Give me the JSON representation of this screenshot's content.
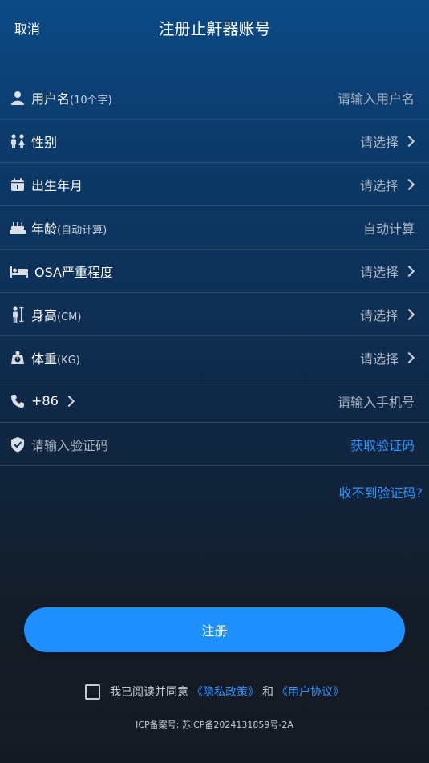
{
  "header": {
    "cancel": "取消",
    "title": "注册止鼾器账号"
  },
  "form": {
    "username": {
      "label": "用户名",
      "hint": "(10个字)",
      "placeholder": "请输入用户名"
    },
    "gender": {
      "label": "性别",
      "value": "请选择"
    },
    "birth": {
      "label": "出生年月",
      "value": "请选择"
    },
    "age": {
      "label": "年龄",
      "hint": "(自动计算)",
      "value": "自动计算"
    },
    "osa": {
      "label": "OSA严重程度",
      "value": "请选择"
    },
    "height": {
      "label": "身高",
      "hint": "(CM)",
      "value": "请选择"
    },
    "weight": {
      "label": "体重",
      "hint": "(KG)",
      "value": "请选择"
    },
    "phone": {
      "code": "+86",
      "placeholder": "请输入手机号"
    },
    "verify": {
      "placeholder": "请输入验证码",
      "action": "获取验证码"
    }
  },
  "no_code": "收不到验证码?",
  "submit": "注册",
  "agreement": {
    "prefix": "我已阅读并同意",
    "privacy": "《隐私政策》",
    "and": "和",
    "user": "《用户协议》"
  },
  "icp": "ICP备案号: 苏ICP备2024131859号-2A",
  "colors": {
    "accent": "#1e90ff",
    "link": "#2f93ff"
  }
}
